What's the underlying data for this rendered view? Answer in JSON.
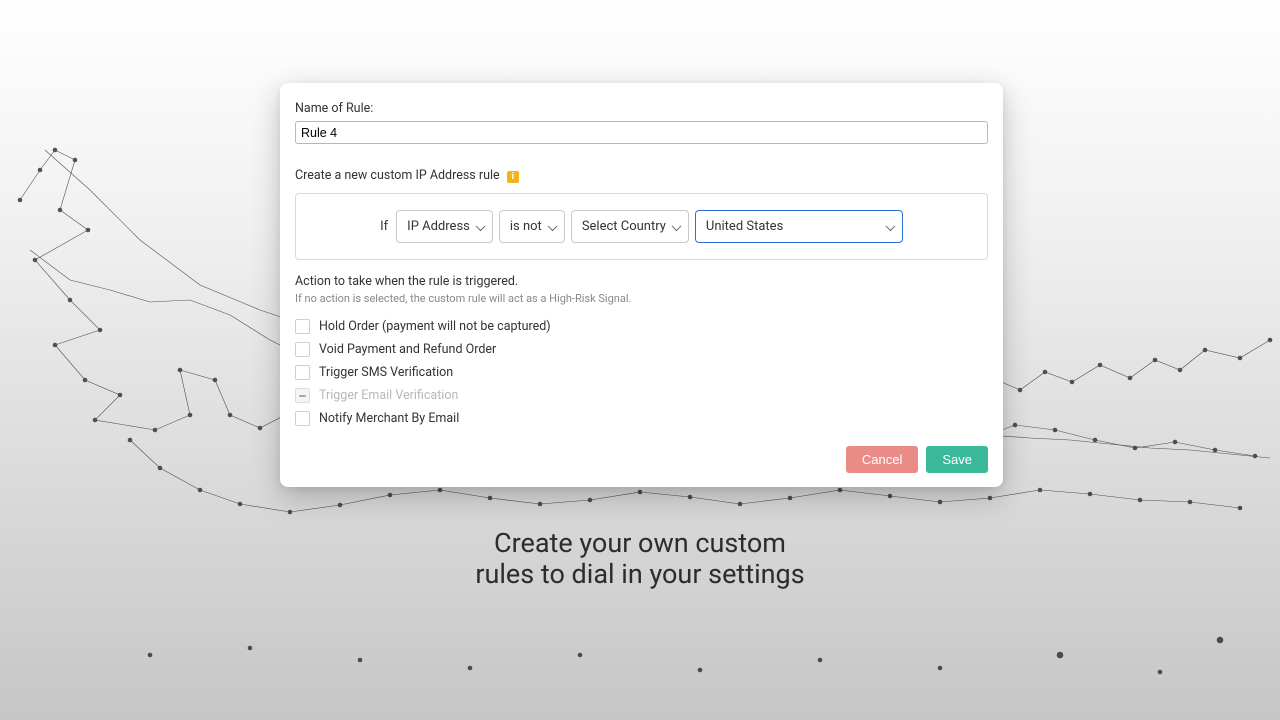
{
  "modal": {
    "name_label": "Name of Rule:",
    "name_value": "Rule 4",
    "create_label": "Create a new custom IP Address rule",
    "help": "i",
    "rule": {
      "if": "If",
      "field": "IP Address",
      "op": "is not",
      "country_placeholder": "Select Country",
      "country_value": "United States"
    },
    "action_title": "Action to take when the rule is triggered.",
    "action_note": "If no action is selected, the custom rule will act as a High-Risk Signal.",
    "actions": {
      "0": "Hold Order (payment will not be captured)",
      "1": "Void Payment and Refund Order",
      "2": "Trigger SMS Verification",
      "3": "Trigger Email Verification",
      "4": "Notify Merchant By Email"
    },
    "buttons": {
      "cancel": "Cancel",
      "save": "Save"
    }
  },
  "caption_line1": "Create your own custom",
  "caption_line2": "rules to dial in your settings",
  "colors": {
    "accent": "#3bb89a",
    "cancel": "#e98b86",
    "focus": "#2e6fd6",
    "help": "#f1b517"
  }
}
